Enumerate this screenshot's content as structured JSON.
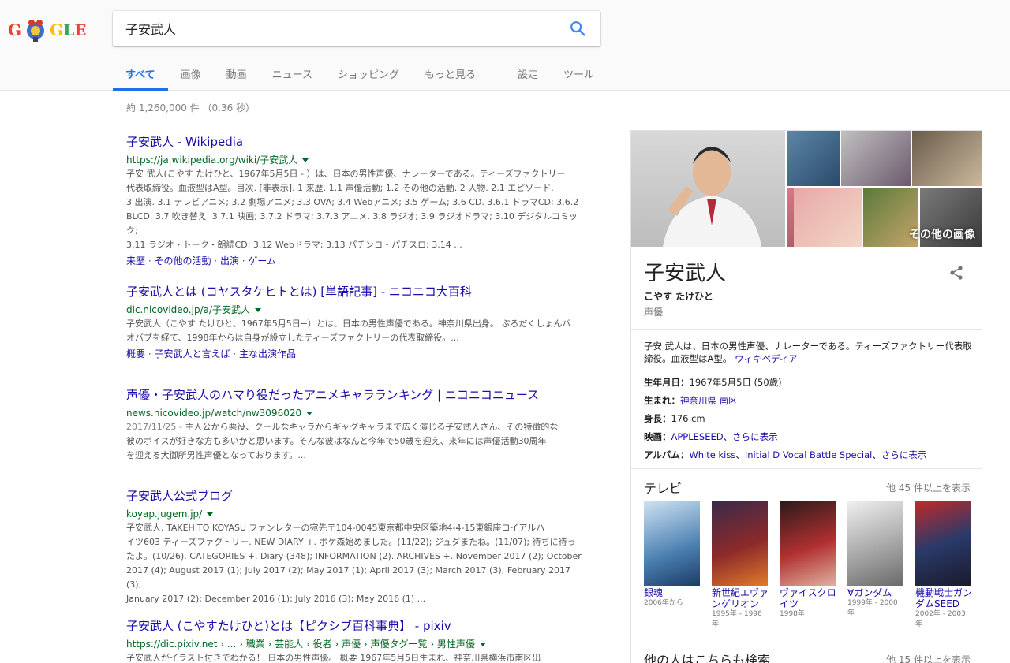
{
  "logo": {
    "letters": [
      "G",
      "O",
      "G",
      "L",
      "E"
    ]
  },
  "search": {
    "query": "子安武人"
  },
  "tabs": [
    {
      "label": "すべて"
    },
    {
      "label": "画像"
    },
    {
      "label": "動画"
    },
    {
      "label": "ニュース"
    },
    {
      "label": "ショッピング"
    },
    {
      "label": "もっと見る"
    }
  ],
  "tools": {
    "settings": "設定",
    "tools": "ツール"
  },
  "stats": "約 1,260,000 件 （0.36 秒）",
  "results": [
    {
      "title": "子安武人 - Wikipedia",
      "url": "https://ja.wikipedia.org/wiki/子安武人",
      "snippet": [
        "子安 武人(こやす たけひと、1967年5月5日 - ）は、日本の男性声優、ナレーターである。ティーズファクトリー",
        "代表取締役。血液型はA型。目次. [非表示]. 1 来歴. 1.1 声優活動; 1.2 その他の活動. 2 人物. 2.1 エピソード.",
        "3 出演. 3.1 テレビアニメ; 3.2 劇場アニメ; 3.3 OVA; 3.4 Webアニメ; 3.5 ゲーム; 3.6 CD. 3.6.1 ドラマCD; 3.6.2",
        "BLCD. 3.7 吹き替え. 3.7.1 映画; 3.7.2 ドラマ; 3.7.3 アニメ. 3.8 ラジオ; 3.9 ラジオドラマ; 3.10 デジタルコミック;",
        "3.11 ラジオ・トーク・朗読CD; 3.12 Webドラマ; 3.13 パチンコ・パチスロ; 3.14 ..."
      ],
      "links": [
        "来歴",
        "その他の活動",
        "出演",
        "ゲーム"
      ]
    },
    {
      "title": "子安武人とは (コヤスタケヒトとは) [単語記事] - ニコニコ大百科",
      "url": "dic.nicovideo.jp/a/子安武人",
      "snippet": [
        "子安武人（こやす たけひと、1967年5月5日−）とは、日本の男性声優である。神奈川県出身。 ぷろだくしょんバ",
        "オバブを経て、1998年からは自身が設立したティーズファクトリーの代表取締役。..."
      ],
      "links": [
        "概要",
        "子安武人と言えば",
        "主な出演作品"
      ]
    },
    {
      "title": "声優・子安武人のハマり役だったアニメキャラランキング | ニコニコニュース",
      "url": "news.nicovideo.jp/watch/nw3096020",
      "date": "2017/11/25 - ",
      "snippet": [
        "主人公から悪役、クールなキャラからギャグキャラまで広く演じる子安武人さん、その特徴的な",
        "彼のボイスが好きな方も多いかと思います。そんな彼はなんと今年で50歳を迎え、来年には声優活動30周年",
        "を迎える大御所男性声優となっております。..."
      ],
      "links": []
    },
    {
      "title": "子安武人公式ブログ",
      "url": "koyap.jugem.jp/",
      "snippet": [
        "子安武人. TAKEHITO KOYASU ファンレターの宛先〒104-0045東京都中央区築地4-4-15東銀座ロイアルハ",
        "イツ603 ティーズファクトリー. NEW DIARY +. ボケ森始めました。(11/22); ジュダまたね。(11/07); 待ちに待っ",
        "たよ。(10/26). CATEGORIES +. Diary (348); INFORMATION (2). ARCHIVES +. November 2017 (2); October",
        "2017 (4); August 2017 (1); July 2017 (2); May 2017 (1); April 2017 (3); March 2017 (3); February 2017 (3);",
        "January 2017 (2); December 2016 (1); July 2016 (3); May 2016 (1) ..."
      ],
      "links": []
    },
    {
      "title": "子安武人 (こやすたけひと)とは【ピクシブ百科事典】 - pixiv",
      "url": "https://dic.pixiv.net › ... › 職業 › 芸能人 › 役者 › 声優 › 声優タグ一覧 › 男性声優",
      "snippet": [
        "子安武人がイラスト付きでわかる！ 日本の男性声優。 概要 1967年5月5日生まれ、神奈川県横浜市南区出"
      ],
      "links": []
    }
  ],
  "kp": {
    "more_images": "その他の画像",
    "title": "子安武人",
    "reading": "こやす たけひと",
    "type": "声優",
    "description": "子安 武人は、日本の男性声優、ナレーターである。ティーズファクトリー代表取締役。血液型はA型。",
    "description_link": "ウィキペディア",
    "facts": {
      "born_label": "生年月日：",
      "born_value": "1967年5月5日 (50歳)",
      "birthplace_label": "生まれ：",
      "birthplace_value": "神奈川県 南区",
      "height_label": "身長：",
      "height_value": "176 cm",
      "movies_label": "映画：",
      "movies_value": "APPLESEED",
      "movies_more": "さらに表示",
      "albums_label": "アルバム：",
      "albums_value1": "White kiss",
      "albums_value2": "Initial D Vocal Battle Special",
      "albums_more": "さらに表示"
    },
    "tv_title": "テレビ",
    "tv_more": "他 45 件以上を表示",
    "tv": [
      {
        "name": "銀魂",
        "year": "2006年から",
        "color": "#4a7fb0"
      },
      {
        "name": "新世紀エヴァンゲリオン",
        "year": "1995年 - 1996年",
        "color": "#8c2a2a"
      },
      {
        "name": "ヴァイスクロイツ",
        "year": "1998年",
        "color": "#b03030"
      },
      {
        "name": "∀ガンダム",
        "year": "1999年 - 2000年",
        "color": "#a8a8a8"
      },
      {
        "name": "機動戦士ガンダムSEED",
        "year": "2002年 - 2003年",
        "color": "#2a3a6a"
      }
    ],
    "also_title": "他の人はこちらも検索",
    "also_more": "他 15 件以上を表示"
  }
}
